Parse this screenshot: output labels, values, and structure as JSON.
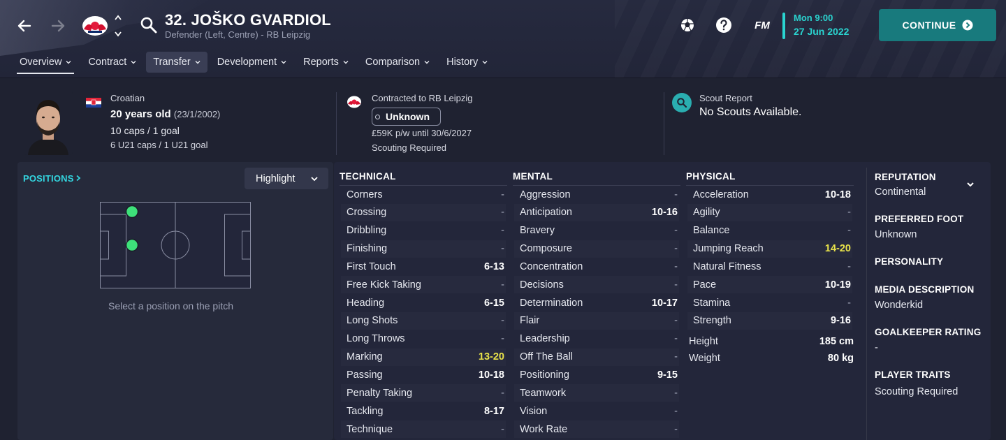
{
  "header": {
    "player_title": "32. JOŠKO GVARDIOL",
    "player_subtitle": "Defender (Left, Centre) - RB Leipzig",
    "logo_text": "FM",
    "date_time": "Mon 9:00",
    "date_day": "27 Jun 2022",
    "continue_label": "CONTINUE",
    "tabs": [
      {
        "label": "Overview"
      },
      {
        "label": "Contract"
      },
      {
        "label": "Transfer"
      },
      {
        "label": "Development"
      },
      {
        "label": "Reports"
      },
      {
        "label": "Comparison"
      },
      {
        "label": "History"
      }
    ]
  },
  "summary": {
    "nationality": "Croatian",
    "age_main": "20 years old",
    "age_dob": "(23/1/2002)",
    "caps": "10 caps / 1 goal",
    "u21_caps": "6 U21 caps / 1 U21 goal",
    "contract_title": "Contracted to RB Leipzig",
    "contract_status": "Unknown",
    "wage": "£59K p/w until 30/6/2027",
    "scouting_required": "Scouting Required",
    "scout_report_title": "Scout Report",
    "scout_report_value": "No Scouts Available."
  },
  "positions": {
    "label": "POSITIONS",
    "highlight_label": "Highlight",
    "hint": "Select a position on the pitch"
  },
  "attributes": {
    "technical_title": "TECHNICAL",
    "mental_title": "MENTAL",
    "physical_title": "PHYSICAL",
    "technical": [
      {
        "name": "Corners",
        "value": "-"
      },
      {
        "name": "Crossing",
        "value": "-"
      },
      {
        "name": "Dribbling",
        "value": "-"
      },
      {
        "name": "Finishing",
        "value": "-"
      },
      {
        "name": "First Touch",
        "value": "6-13"
      },
      {
        "name": "Free Kick Taking",
        "value": "-"
      },
      {
        "name": "Heading",
        "value": "6-15"
      },
      {
        "name": "Long Shots",
        "value": "-"
      },
      {
        "name": "Long Throws",
        "value": "-"
      },
      {
        "name": "Marking",
        "value": "13-20"
      },
      {
        "name": "Passing",
        "value": "10-18"
      },
      {
        "name": "Penalty Taking",
        "value": "-"
      },
      {
        "name": "Tackling",
        "value": "8-17"
      },
      {
        "name": "Technique",
        "value": "-"
      }
    ],
    "mental": [
      {
        "name": "Aggression",
        "value": "-"
      },
      {
        "name": "Anticipation",
        "value": "10-16"
      },
      {
        "name": "Bravery",
        "value": "-"
      },
      {
        "name": "Composure",
        "value": "-"
      },
      {
        "name": "Concentration",
        "value": "-"
      },
      {
        "name": "Decisions",
        "value": "-"
      },
      {
        "name": "Determination",
        "value": "10-17"
      },
      {
        "name": "Flair",
        "value": "-"
      },
      {
        "name": "Leadership",
        "value": "-"
      },
      {
        "name": "Off The Ball",
        "value": "-"
      },
      {
        "name": "Positioning",
        "value": "9-15"
      },
      {
        "name": "Teamwork",
        "value": "-"
      },
      {
        "name": "Vision",
        "value": "-"
      },
      {
        "name": "Work Rate",
        "value": "-"
      }
    ],
    "physical": [
      {
        "name": "Acceleration",
        "value": "10-18"
      },
      {
        "name": "Agility",
        "value": "-"
      },
      {
        "name": "Balance",
        "value": "-"
      },
      {
        "name": "Jumping Reach",
        "value": "14-20"
      },
      {
        "name": "Natural Fitness",
        "value": "-"
      },
      {
        "name": "Pace",
        "value": "10-19"
      },
      {
        "name": "Stamina",
        "value": "-"
      },
      {
        "name": "Strength",
        "value": "9-16"
      }
    ],
    "height_label": "Height",
    "height_value": "185 cm",
    "weight_label": "Weight",
    "weight_value": "80 kg"
  },
  "info": {
    "reputation_title": "REPUTATION",
    "reputation_value": "Continental",
    "foot_title": "PREFERRED FOOT",
    "foot_value": "Unknown",
    "personality_title": "PERSONALITY",
    "media_title": "MEDIA DESCRIPTION",
    "media_value": "Wonderkid",
    "gk_title": "GOALKEEPER RATING",
    "gk_value": "-",
    "traits_title": "PLAYER TRAITS",
    "traits_value": "Scouting Required"
  },
  "colors": {
    "accent_cyan": "#2ad4d0",
    "continue_bg": "#187a7d",
    "highlight_yellow": "#e9e34a",
    "position_dot": "#3ee07a"
  }
}
